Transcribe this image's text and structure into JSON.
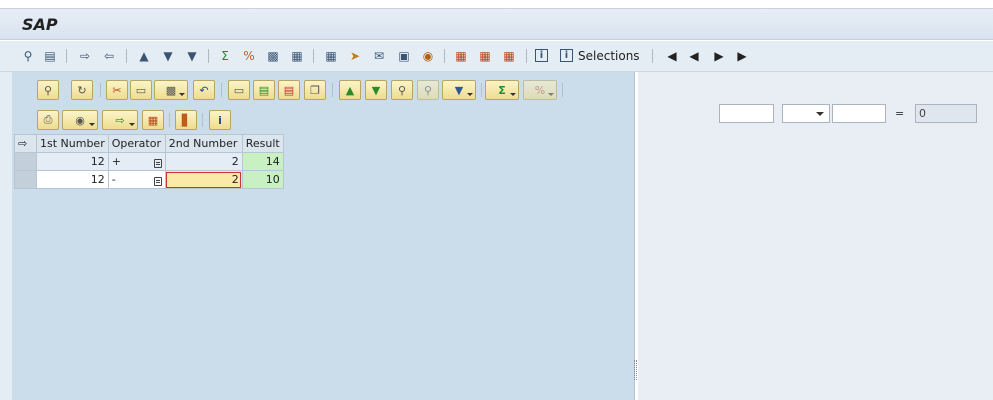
{
  "app": {
    "title": "SAP"
  },
  "toolbar": {
    "selections_label": "Selections",
    "icons": [
      "details-icon",
      "table-icon",
      "export-icon",
      "import-icon",
      "sort-ascending-icon",
      "sort-descending-icon",
      "filter-icon",
      "sum-icon",
      "subtotal-icon",
      "print-preview-icon",
      "layout-icon",
      "excel-icon",
      "word-icon",
      "send-icon",
      "graphic-icon",
      "abc-icon",
      "grid-icon",
      "columns-icon",
      "rows-icon",
      "info-icon",
      "selections-info-icon",
      "first-page-icon",
      "previous-page-icon",
      "next-page-icon",
      "last-page-icon"
    ]
  },
  "alv_toolbar": {
    "row1_icons": [
      "details-icon",
      "refresh-icon",
      "cut-icon",
      "copy-icon",
      "paste-icon",
      "undo-icon",
      "new-row-icon",
      "insert-row-icon",
      "delete-row-icon",
      "duplicate-row-icon",
      "sort-ascending-icon",
      "sort-descending-icon",
      "find-icon",
      "find-next-icon",
      "filter-icon",
      "sum-icon",
      "subtotal-icon"
    ],
    "row2_icons": [
      "print-icon",
      "views-icon",
      "export-icon",
      "layout-icon",
      "graphic-icon",
      "info-icon"
    ]
  },
  "grid": {
    "columns": [
      "1st Number",
      "Operator",
      "2nd Number",
      "Result"
    ],
    "rows": [
      {
        "first": "12",
        "operator": "+",
        "second": "2",
        "result": "14"
      },
      {
        "first": "12",
        "operator": "-",
        "second": "2",
        "result": "10"
      }
    ]
  },
  "calculator": {
    "first_value": "",
    "operator_value": "",
    "second_value": "",
    "equals_label": "=",
    "result_value": "0"
  },
  "colors": {
    "accent": "#f6e7a3",
    "result_bg": "#c9f0c2",
    "panel_bg": "#cbdcea"
  }
}
